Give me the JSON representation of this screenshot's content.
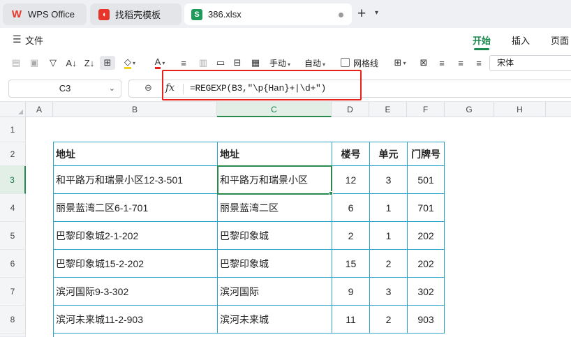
{
  "tabs": {
    "wps": "WPS Office",
    "template": "找稻壳模板",
    "file": "386.xlsx",
    "s_badge": "S"
  },
  "menu": {
    "file": "文件",
    "tabs": [
      "开始",
      "插入",
      "页面"
    ]
  },
  "toolbar": {
    "manual_label": "手动",
    "auto_label": "自动",
    "gridlines_label": "网格线",
    "font_name": "宋体"
  },
  "formula_bar": {
    "cell_ref": "C3",
    "fx": "fx",
    "formula": "=REGEXP(B3,\"\\p{Han}+|\\d+\")"
  },
  "grid": {
    "columns": [
      "A",
      "B",
      "C",
      "D",
      "E",
      "F",
      "G",
      "H"
    ],
    "rows": [
      "1",
      "2",
      "3",
      "4",
      "5",
      "6",
      "7",
      "8"
    ],
    "active_cell": "C3",
    "table": {
      "headers": [
        "地址",
        "地址",
        "楼号",
        "单元",
        "门牌号"
      ],
      "rows": [
        [
          "和平路万和瑞景小区12-3-501",
          "和平路万和瑞景小区",
          "12",
          "3",
          "501"
        ],
        [
          "丽景蓝湾二区6-1-701",
          "丽景蓝湾二区",
          "6",
          "1",
          "701"
        ],
        [
          "巴黎印象城2-1-202",
          "巴黎印象城",
          "2",
          "1",
          "202"
        ],
        [
          "巴黎印象城15-2-202",
          "巴黎印象城",
          "15",
          "2",
          "202"
        ],
        [
          "滨河国际9-3-302",
          "滨河国际",
          "9",
          "3",
          "302"
        ],
        [
          "滨河未来城11-2-903",
          "滨河未来城",
          "11",
          "2",
          "903"
        ]
      ]
    }
  },
  "colors": {
    "accent_green": "#1a8a4e",
    "table_border": "#2aa4c8",
    "highlight_red": "#e8221b"
  }
}
